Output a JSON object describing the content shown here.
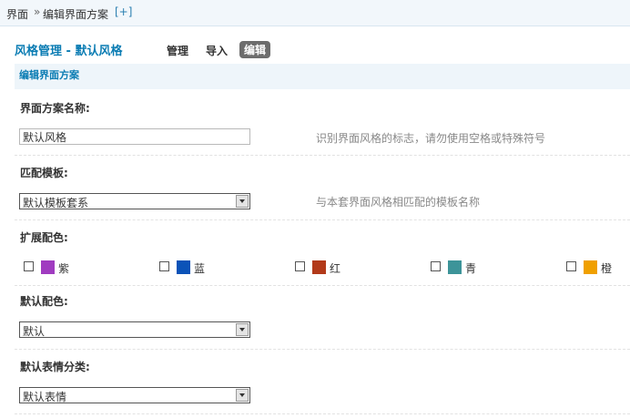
{
  "breadcrumb": {
    "home": "界面",
    "separator": "»",
    "current": "编辑界面方案",
    "add": "[+]"
  },
  "header": {
    "title": "风格管理 - 默认风格",
    "tabs": [
      {
        "label": "管理",
        "active": false
      },
      {
        "label": "导入",
        "active": false
      },
      {
        "label": "编辑",
        "active": true
      }
    ]
  },
  "section": {
    "title": "编辑界面方案"
  },
  "fields": {
    "name": {
      "label": "界面方案名称:",
      "value": "默认风格",
      "hint": "识别界面风格的标志，请勿使用空格或特殊符号"
    },
    "template": {
      "label": "匹配模板:",
      "value": "默认模板套系",
      "hint": "与本套界面风格相匹配的模板名称"
    },
    "colors": {
      "label": "扩展配色:",
      "options": [
        {
          "name": "紫",
          "color": "#a03cc0",
          "checked": false
        },
        {
          "name": "蓝",
          "color": "#0b53b8",
          "checked": false
        },
        {
          "name": "红",
          "color": "#b23a1a",
          "checked": false
        },
        {
          "name": "青",
          "color": "#3d9499",
          "checked": false
        },
        {
          "name": "橙",
          "color": "#f0a000",
          "checked": false
        }
      ]
    },
    "default_color": {
      "label": "默认配色:",
      "value": "默认"
    },
    "emoticon": {
      "label": "默认表情分类:",
      "value": "默认表情"
    }
  }
}
